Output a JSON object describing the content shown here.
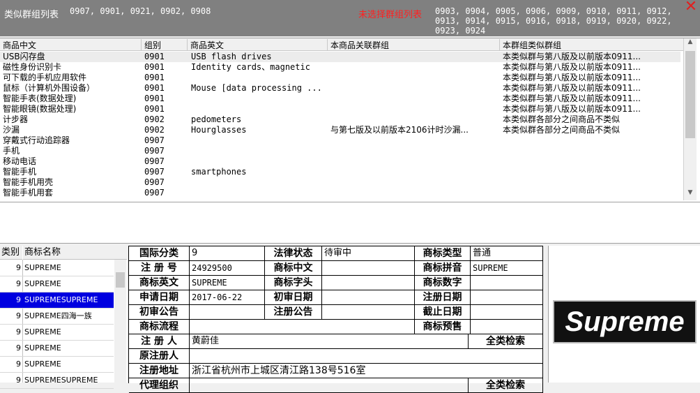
{
  "header": {
    "similar_label": "类似群组列表",
    "similar_groups": "0907, 0901, 0921, 0902, 0908",
    "unselected_label": "未选择群组列表",
    "unselected_groups": "0903, 0904, 0905, 0906, 0909, 0910, 0911, 0912, 0913, 0914, 0915, 0916, 0918, 0919, 0920, 0922, 0923, 0924"
  },
  "goods_table": {
    "columns": [
      "商品中文",
      "组别",
      "商品英文",
      "本商品关联群组",
      "本群组类似群组"
    ],
    "rows": [
      {
        "cn": "USB闪存盘",
        "group": "0901",
        "en": "USB flash drives",
        "related": "",
        "similar": "本类似群与第八版及以前版本0911..."
      },
      {
        "cn": "磁性身份识别卡",
        "group": "0901",
        "en": "Identity cards、magnetic",
        "related": "",
        "similar": "本类似群与第八版及以前版本0911..."
      },
      {
        "cn": "可下载的手机应用软件",
        "group": "0901",
        "en": "",
        "related": "",
        "similar": "本类似群与第八版及以前版本0911..."
      },
      {
        "cn": "鼠标（计算机外围设备）",
        "group": "0901",
        "en": "Mouse [data processing ...",
        "related": "",
        "similar": "本类似群与第八版及以前版本0911..."
      },
      {
        "cn": "智能手表(数据处理)",
        "group": "0901",
        "en": "",
        "related": "",
        "similar": "本类似群与第八版及以前版本0911..."
      },
      {
        "cn": "智能眼镜(数据处理)",
        "group": "0901",
        "en": "",
        "related": "",
        "similar": "本类似群与第八版及以前版本0911..."
      },
      {
        "cn": "计步器",
        "group": "0902",
        "en": "pedometers",
        "related": "",
        "similar": "本类似群各部分之间商品不类似"
      },
      {
        "cn": "沙漏",
        "group": "0902",
        "en": "Hourglasses",
        "related": "与第七版及以前版本2106计时沙漏...",
        "similar": "本类似群各部分之间商品不类似"
      },
      {
        "cn": "穿戴式行动追踪器",
        "group": "0907",
        "en": "",
        "related": "",
        "similar": ""
      },
      {
        "cn": "手机",
        "group": "0907",
        "en": "",
        "related": "",
        "similar": ""
      },
      {
        "cn": "移动电话",
        "group": "0907",
        "en": "",
        "related": "",
        "similar": ""
      },
      {
        "cn": "智能手机",
        "group": "0907",
        "en": "smartphones",
        "related": "",
        "similar": ""
      },
      {
        "cn": "智能手机用壳",
        "group": "0907",
        "en": "",
        "related": "",
        "similar": ""
      },
      {
        "cn": "智能手机用套",
        "group": "0907",
        "en": "",
        "related": "",
        "similar": ""
      }
    ]
  },
  "class_list": {
    "col_class": "类别",
    "col_name": "商标名称",
    "rows": [
      {
        "cls": "9",
        "name": "SUPREME"
      },
      {
        "cls": "9",
        "name": "SUPREME"
      },
      {
        "cls": "9",
        "name": "SUPREMESUPREME"
      },
      {
        "cls": "9",
        "name": "SUPREME四海一族"
      },
      {
        "cls": "9",
        "name": "SUPREME"
      },
      {
        "cls": "9",
        "name": "SUPREME"
      },
      {
        "cls": "9",
        "name": "SUPREME"
      },
      {
        "cls": "9",
        "name": "SUPREMESUPREME"
      }
    ]
  },
  "info": {
    "intl_class_label": "国际分类",
    "intl_class": "9",
    "legal_status_label": "法律状态",
    "legal_status": "待审中",
    "tm_type_label": "商标类型",
    "tm_type": "普通",
    "reg_no_label": "注 册 号",
    "reg_no": "24929500",
    "tm_cn_label": "商标中文",
    "tm_cn": "",
    "tm_pinyin_label": "商标拼音",
    "tm_pinyin": "SUPREME",
    "tm_en_label": "商标英文",
    "tm_en": "SUPREME",
    "tm_initial_label": "商标字头",
    "tm_initial": "",
    "tm_digit_label": "商标数字",
    "tm_digit": "",
    "apply_date_label": "申请日期",
    "apply_date": "2017-06-22",
    "prelim_date_label": "初审日期",
    "prelim_date": "",
    "reg_date_label": "注册日期",
    "reg_date": "",
    "prelim_notice_label": "初审公告",
    "prelim_notice": "",
    "reg_notice_label": "注册公告",
    "reg_notice": "",
    "deadline_label": "截止日期",
    "deadline": "",
    "process_label": "商标流程",
    "process": "",
    "presale_label": "商标预售",
    "presale": "",
    "registrant_label": "注 册 人",
    "registrant": "黄蔚佳",
    "search_all_label": "全类检索",
    "orig_registrant_label": "原注册人",
    "orig_registrant": "",
    "address_label": "注册地址",
    "address": "浙江省杭州市上城区清江路138号516室",
    "agency_label": "代理组织",
    "search_all_label2": "全类检索"
  },
  "image": {
    "logo_text": "Supreme"
  },
  "colors": {
    "header_bg": "#808080",
    "unselected_label": "#ff2020",
    "selected_row": "#0000e0"
  }
}
